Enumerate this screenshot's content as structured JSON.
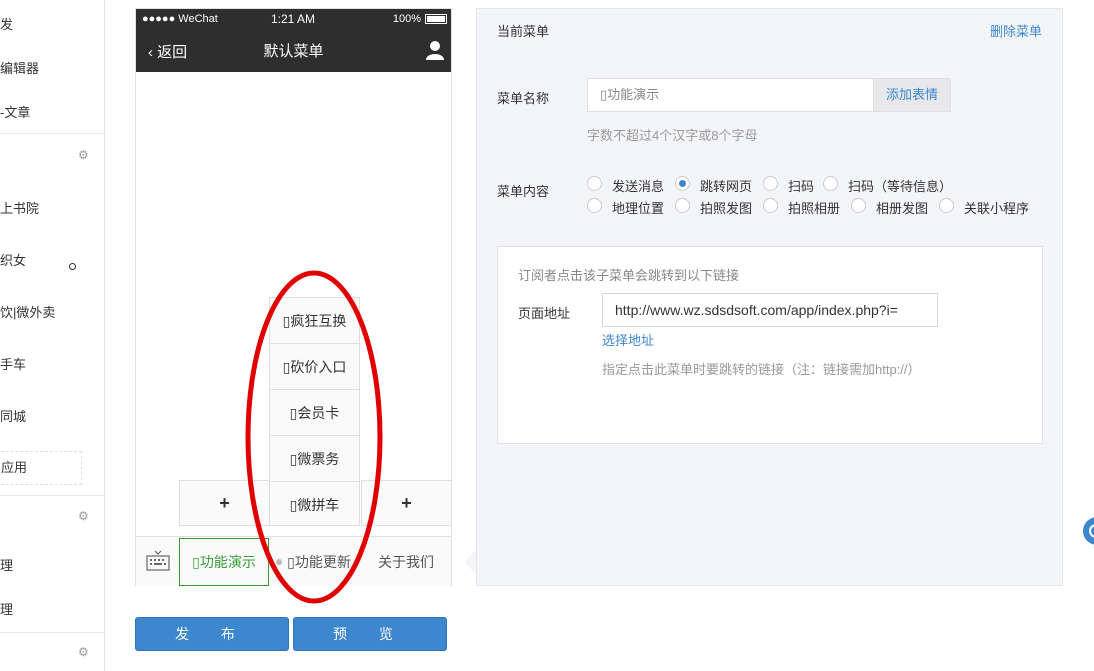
{
  "sidebar": {
    "items": [
      "发",
      "编辑器",
      "-文章",
      "上书院",
      "织女",
      "饮|微外卖",
      "手车",
      "同城",
      "应用",
      "理",
      "理"
    ]
  },
  "phone": {
    "status": {
      "signal": "●●●●● WeChat",
      "time": "1:21 AM",
      "battery": "100%"
    },
    "nav": {
      "back": "返回",
      "title": "默认菜单"
    },
    "submenu": [
      "▯疯狂互换",
      "▯砍价入口",
      "▯会员卡",
      "▯微票务",
      "▯微拼车"
    ],
    "plus": "+",
    "menubar": [
      "▯功能演示",
      "▯功能更新",
      "关于我们"
    ]
  },
  "buttons": {
    "publish": "发  布",
    "preview": "预  览"
  },
  "panel": {
    "header": "当前菜单",
    "delete": "删除菜单",
    "name_label": "菜单名称",
    "name_value": "▯功能演示",
    "add_emoji": "添加表情",
    "name_hint": "字数不超过4个汉字或8个字母",
    "content_label": "菜单内容",
    "options_row1": [
      "发送消息",
      "跳转网页",
      "扫码",
      "扫码（等待信息）"
    ],
    "options_row2": [
      "地理位置",
      "拍照发图",
      "拍照相册",
      "相册发图",
      "关联小程序"
    ],
    "selected_option": "跳转网页",
    "link": {
      "heading": "订阅者点击该子菜单会跳转到以下链接",
      "url_label": "页面地址",
      "url_value": "http://www.wz.sdsdsoft.com/app/index.php?i=",
      "choose": "选择地址",
      "hint": "指定点击此菜单时要跳转的链接（注：链接需加http://）"
    }
  },
  "colors": {
    "accent": "#3d87cf",
    "dark_bar": "#2e2e2e",
    "active_green": "#3a9b3a",
    "annotation_red": "#e00000"
  }
}
